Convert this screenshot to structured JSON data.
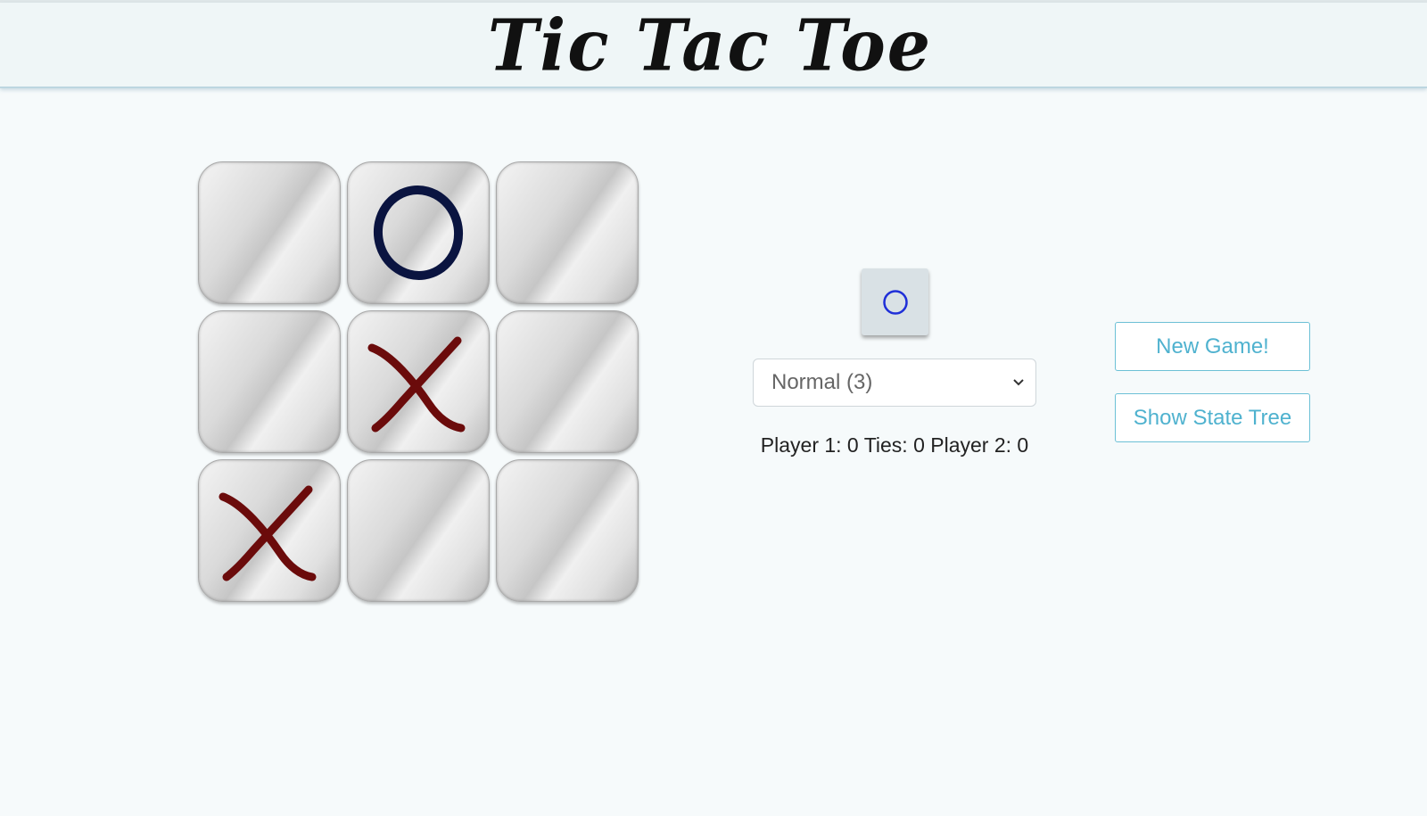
{
  "header": {
    "title": "Tic Tac Toe"
  },
  "board": {
    "cells": [
      "",
      "O",
      "",
      "",
      "X",
      "",
      "X",
      "",
      ""
    ]
  },
  "turn_indicator": {
    "current_symbol": "O",
    "icon": "circle-icon"
  },
  "difficulty": {
    "selected": "Normal (3)"
  },
  "scores": {
    "text": "Player 1: 0 Ties: 0 Player 2: 0"
  },
  "buttons": {
    "new_game": "New Game!",
    "show_state_tree": "Show State Tree"
  },
  "colors": {
    "x_mark": "#6b0b0b",
    "o_mark": "#0a1440",
    "turn_circle": "#1f2fd8",
    "button_accent": "#4fb2cf"
  }
}
